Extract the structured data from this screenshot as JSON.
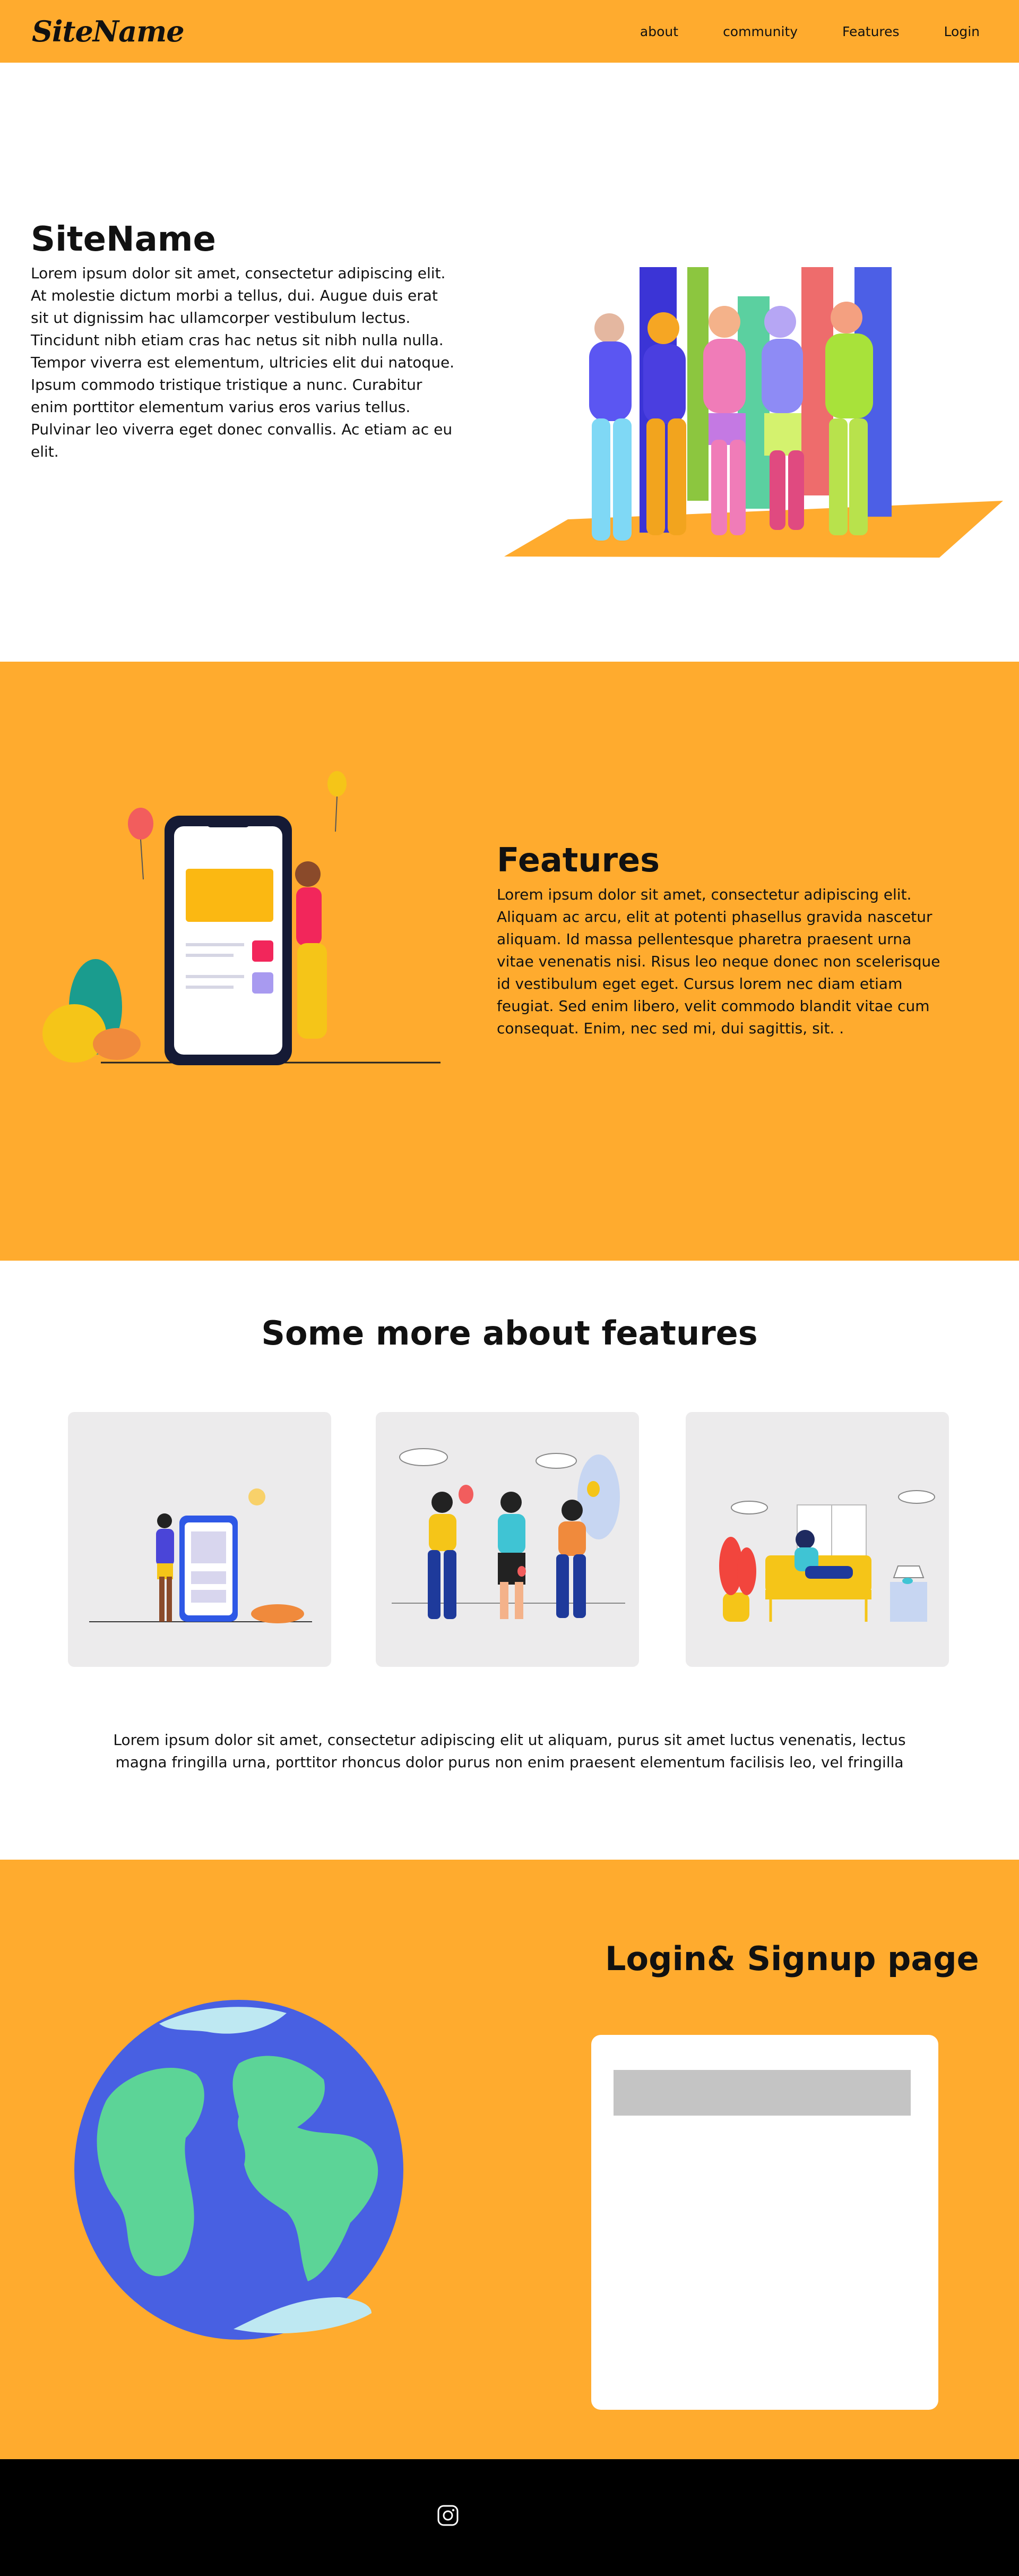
{
  "header": {
    "logo": "SiteName",
    "nav": [
      "about",
      "community",
      "Features",
      "Login"
    ]
  },
  "hero": {
    "title": "SiteName",
    "body": "Lorem ipsum dolor sit amet, consectetur adipiscing elit. At molestie dictum morbi a tellus, dui. Augue duis erat sit ut dignissim hac ullamcorper vestibulum lectus. Tincidunt nibh etiam cras hac netus sit nibh nulla nulla. Tempor viverra est elementum, ultricies elit dui natoque. Ipsum commodo tristique tristique a nunc. Curabitur enim porttitor elementum varius eros varius tellus. Pulvinar leo viverra eget donec convallis. Ac etiam ac eu elit."
  },
  "features": {
    "title": "Features",
    "body": "Lorem ipsum dolor sit amet, consectetur adipiscing elit. Aliquam ac arcu, elit at potenti phasellus gravida nascetur aliquam. Id massa pellentesque pharetra praesent urna vitae venenatis nisi. Risus leo neque donec non scelerisque id vestibulum eget eget. Cursus lorem nec diam etiam feugiat. Sed enim libero, velit commodo blandit vitae cum consequat. Enim, nec sed mi, dui sagittis, sit. ."
  },
  "more": {
    "title": "Some more about features",
    "description": "Lorem ipsum dolor sit amet, consectetur adipiscing elit ut aliquam, purus sit amet luctus venenatis, lectus magna fringilla urna, porttitor rhoncus dolor purus non enim praesent elementum facilisis leo, vel fringilla"
  },
  "login": {
    "title": "Login& Signup page",
    "input_value": ""
  },
  "footer": {
    "icon": "instagram-icon"
  },
  "colors": {
    "brand": "#FFAB2E",
    "footer": "#000000"
  }
}
